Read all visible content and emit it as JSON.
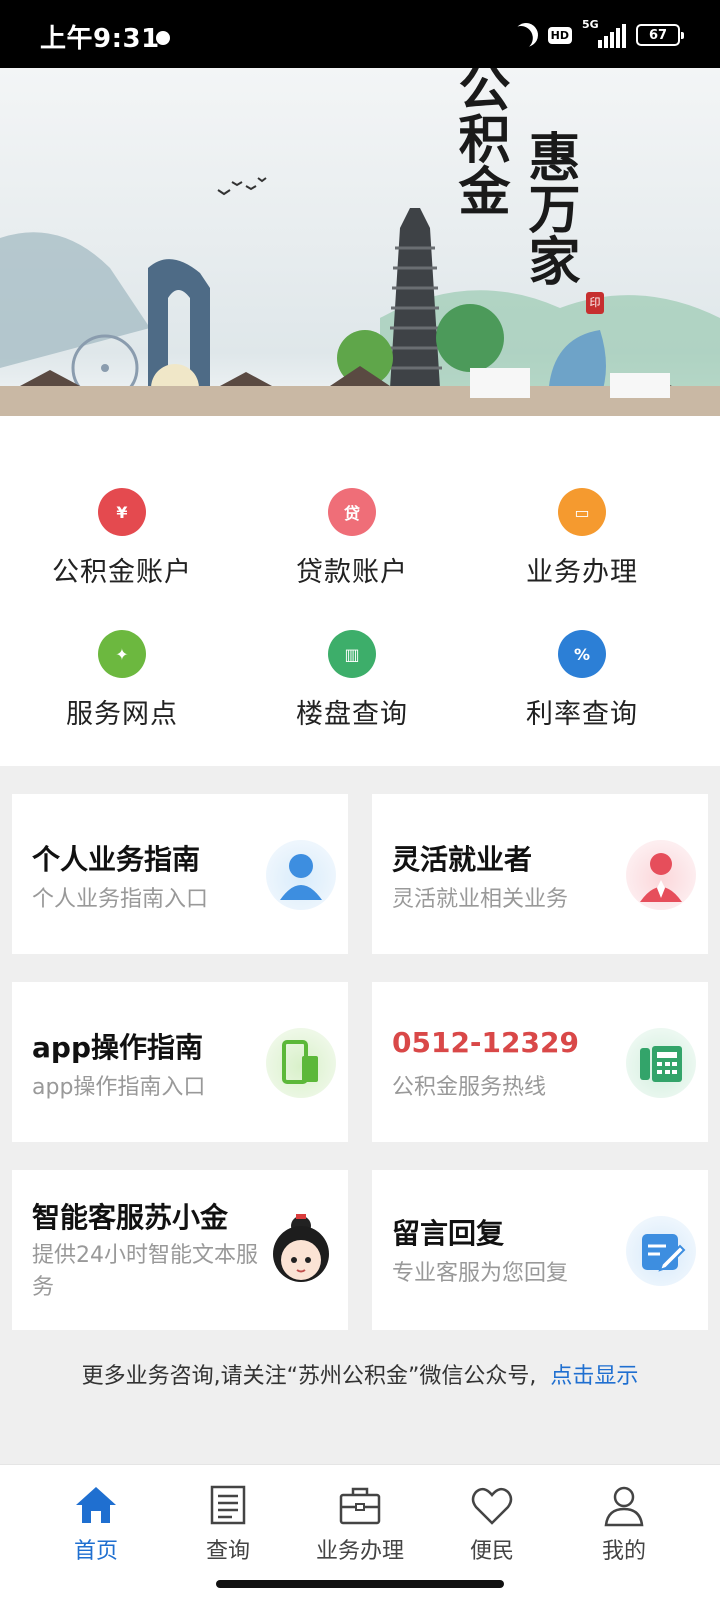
{
  "status_bar": {
    "time": "上午9:31",
    "hd": "HD",
    "network": "5G",
    "battery": "67"
  },
  "banner": {
    "line1": "公积金",
    "line2": "惠万家",
    "seal": "印"
  },
  "menu": [
    {
      "label": "公积金账户",
      "glyph": "¥",
      "color": "#e44a4f",
      "icon": "money-bag-icon"
    },
    {
      "label": "贷款账户",
      "glyph": "贷",
      "color": "#ef6e78",
      "icon": "loan-bag-icon"
    },
    {
      "label": "业务办理",
      "glyph": "▭",
      "color": "#f59a2f",
      "icon": "briefcase-icon"
    },
    {
      "label": "服务网点",
      "glyph": "✦",
      "color": "#6cb83f",
      "icon": "network-icon"
    },
    {
      "label": "楼盘查询",
      "glyph": "▥",
      "color": "#3dae6a",
      "icon": "building-icon"
    },
    {
      "label": "利率查询",
      "glyph": "%",
      "color": "#2c7fd6",
      "icon": "percent-icon"
    }
  ],
  "cards": [
    {
      "title": "个人业务指南",
      "sub": "个人业务指南入口",
      "icon": "person-icon"
    },
    {
      "title": "灵活就业者",
      "sub": "灵活就业相关业务",
      "icon": "worker-icon"
    },
    {
      "title": "app操作指南",
      "sub": "app操作指南入口",
      "icon": "mobile-phone-icon"
    },
    {
      "title": "0512-12329",
      "sub": "公积金服务热线",
      "icon": "telephone-icon"
    },
    {
      "title": "智能客服苏小金",
      "sub": "提供24小时智能文本服务",
      "icon": "mascot-avatar-icon"
    },
    {
      "title": "留言回复",
      "sub": "专业客服为您回复",
      "icon": "edit-note-icon"
    }
  ],
  "footer": {
    "text": "更多业务咨询,请关注“苏州公积金”微信公众号,",
    "link": "点击显示"
  },
  "tabs": [
    {
      "label": "首页",
      "icon": "home-icon",
      "active": true
    },
    {
      "label": "查询",
      "icon": "document-icon",
      "active": false
    },
    {
      "label": "业务办理",
      "icon": "briefcase-icon",
      "active": false
    },
    {
      "label": "便民",
      "icon": "heart-icon",
      "active": false
    },
    {
      "label": "我的",
      "icon": "user-icon",
      "active": false
    }
  ],
  "colors": {
    "accent": "#1f6fd0",
    "hotline": "#d94848"
  }
}
